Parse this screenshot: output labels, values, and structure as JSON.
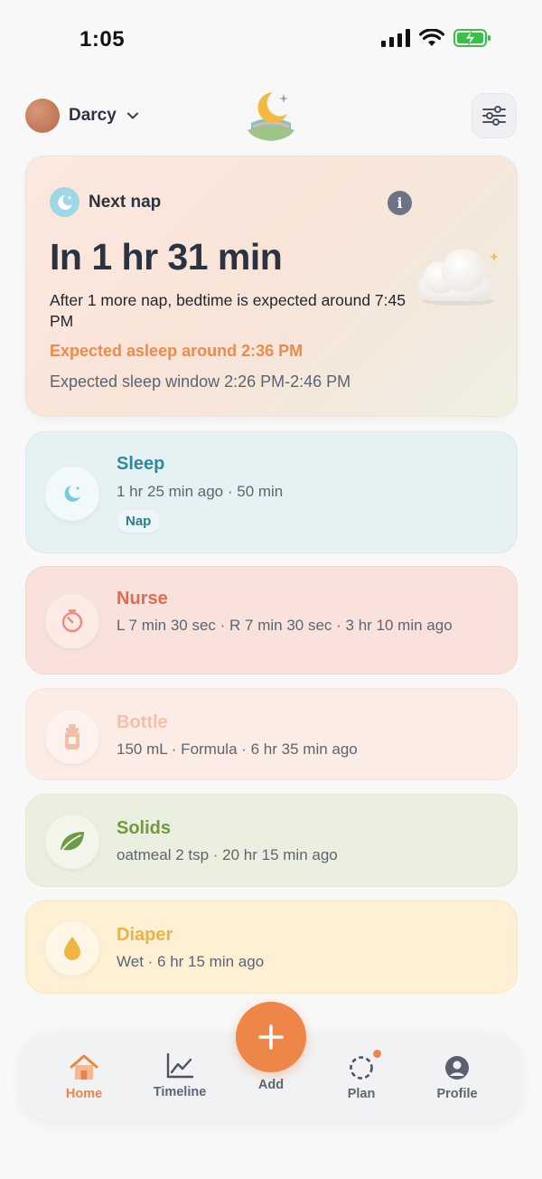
{
  "status_bar": {
    "time": "1:05"
  },
  "header": {
    "user_name": "Darcy"
  },
  "next_nap": {
    "label": "Next nap",
    "countdown": "In 1 hr 31 min",
    "subtitle": "After 1 more nap, bedtime is expected around 7:45 PM",
    "expected_asleep": "Expected asleep around 2:36 PM",
    "sleep_window": "Expected sleep window 2:26 PM-2:46 PM"
  },
  "events": {
    "sleep": {
      "title": "Sleep",
      "detail": "1 hr 25 min ago · 50 min",
      "tag": "Nap"
    },
    "nurse": {
      "title": "Nurse",
      "detail": "L 7 min 30 sec · R 7 min 30 sec · 3 hr 10 min ago"
    },
    "bottle": {
      "title": "Bottle",
      "detail": "150 mL · Formula · 6 hr 35 min ago"
    },
    "solids": {
      "title": "Solids",
      "detail": "oatmeal 2 tsp · 20 hr 15 min ago"
    },
    "diaper": {
      "title": "Diaper",
      "detail": "Wet · 6 hr 15 min ago"
    }
  },
  "nav": {
    "home": "Home",
    "timeline": "Timeline",
    "add": "Add",
    "plan": "Plan",
    "profile": "Profile"
  },
  "icons": {
    "signal": "signal-icon",
    "wifi": "wifi-icon",
    "battery": "battery-charging-icon",
    "chevron": "chevron-down-icon",
    "filter": "sliders-icon",
    "moon": "moon-icon",
    "info": "info-icon",
    "timer": "timer-icon",
    "bottle": "bottle-icon",
    "leaf": "leaf-icon",
    "drop": "drop-icon",
    "home": "home-icon",
    "chart": "chart-icon",
    "plus": "plus-icon",
    "plan": "plan-icon",
    "profile": "profile-icon"
  },
  "colors": {
    "accent": "#ee8549",
    "sleep": "#2f8a9a",
    "nurse": "#e06a53",
    "bottle": "#f1c1ae",
    "solids": "#6f9a3e",
    "diaper": "#eab447"
  }
}
